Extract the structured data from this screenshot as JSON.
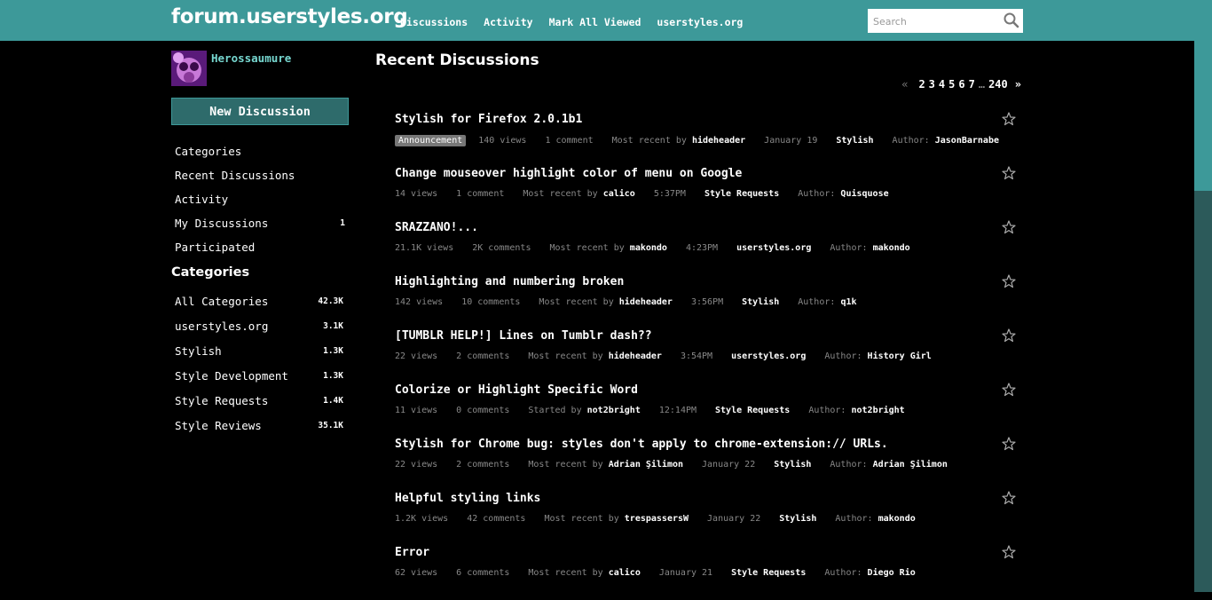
{
  "header": {
    "site_title": "forum.userstyles.org",
    "nav": [
      "Discussions",
      "Activity",
      "Mark All Viewed",
      "userstyles.org"
    ],
    "search_placeholder": "Search"
  },
  "user": {
    "name": "Herossaumure"
  },
  "sidebar": {
    "new_discussion": "New Discussion",
    "nav": [
      {
        "label": "Categories",
        "count": ""
      },
      {
        "label": "Recent Discussions",
        "count": ""
      },
      {
        "label": "Activity",
        "count": ""
      },
      {
        "label": "My Discussions",
        "count": "1"
      },
      {
        "label": "Participated",
        "count": ""
      }
    ],
    "categories_heading": "Categories",
    "categories": [
      {
        "label": "All Categories",
        "count": "42.3K"
      },
      {
        "label": "userstyles.org",
        "count": "3.1K"
      },
      {
        "label": "Stylish",
        "count": "1.3K"
      },
      {
        "label": "Style Development",
        "count": "1.3K"
      },
      {
        "label": "Style Requests",
        "count": "1.4K"
      },
      {
        "label": "Style Reviews",
        "count": "35.1K"
      }
    ]
  },
  "main": {
    "heading": "Recent Discussions",
    "pager": {
      "prev": "«",
      "pages": [
        "2",
        "3",
        "4",
        "5",
        "6",
        "7"
      ],
      "ellipsis": "…",
      "last": "240",
      "next": "»"
    },
    "discussions": [
      {
        "title": "Stylish for Firefox 2.0.1b1",
        "badge": "Announcement",
        "views": "140 views",
        "comments": "1 comment",
        "recent_label": "Most recent by",
        "recent_user": "hideheader",
        "time": "January 19",
        "category": "Stylish",
        "author_label": "Author:",
        "author": "JasonBarnabe"
      },
      {
        "title": "Change mouseover highlight color of menu on Google",
        "badge": "",
        "views": "14 views",
        "comments": "1 comment",
        "recent_label": "Most recent by",
        "recent_user": "calico",
        "time": "5:37PM",
        "category": "Style Requests",
        "author_label": "Author:",
        "author": "Quisquose"
      },
      {
        "title": "SRAZZANO!...",
        "badge": "",
        "views": "21.1K views",
        "comments": "2K comments",
        "recent_label": "Most recent by",
        "recent_user": "makondo",
        "time": "4:23PM",
        "category": "userstyles.org",
        "author_label": "Author:",
        "author": "makondo"
      },
      {
        "title": "Highlighting and numbering broken",
        "badge": "",
        "views": "142 views",
        "comments": "10 comments",
        "recent_label": "Most recent by",
        "recent_user": "hideheader",
        "time": "3:56PM",
        "category": "Stylish",
        "author_label": "Author:",
        "author": "q1k"
      },
      {
        "title": "[TUMBLR HELP!] Lines on Tumblr dash??",
        "badge": "",
        "views": "22 views",
        "comments": "2 comments",
        "recent_label": "Most recent by",
        "recent_user": "hideheader",
        "time": "3:54PM",
        "category": "userstyles.org",
        "author_label": "Author:",
        "author": "History Girl"
      },
      {
        "title": "Colorize or Highlight Specific Word",
        "badge": "",
        "views": "11 views",
        "comments": "0 comments",
        "recent_label": "Started by",
        "recent_user": "not2bright",
        "time": "12:14PM",
        "category": "Style Requests",
        "author_label": "Author:",
        "author": "not2bright"
      },
      {
        "title": "Stylish for Chrome bug: styles don't apply to chrome-extension:// URLs.",
        "badge": "",
        "views": "22 views",
        "comments": "2 comments",
        "recent_label": "Most recent by",
        "recent_user": "Adrian Şilimon",
        "time": "January 22",
        "category": "Stylish",
        "author_label": "Author:",
        "author": "Adrian Şilimon"
      },
      {
        "title": "Helpful styling links",
        "badge": "",
        "views": "1.2K views",
        "comments": "42 comments",
        "recent_label": "Most recent by",
        "recent_user": "trespassersW",
        "time": "January 22",
        "category": "Stylish",
        "author_label": "Author:",
        "author": "makondo"
      },
      {
        "title": "Error",
        "badge": "",
        "views": "62 views",
        "comments": "6 comments",
        "recent_label": "Most recent by",
        "recent_user": "calico",
        "time": "January 21",
        "category": "Style Requests",
        "author_label": "Author:",
        "author": "Diego Rio"
      }
    ]
  }
}
